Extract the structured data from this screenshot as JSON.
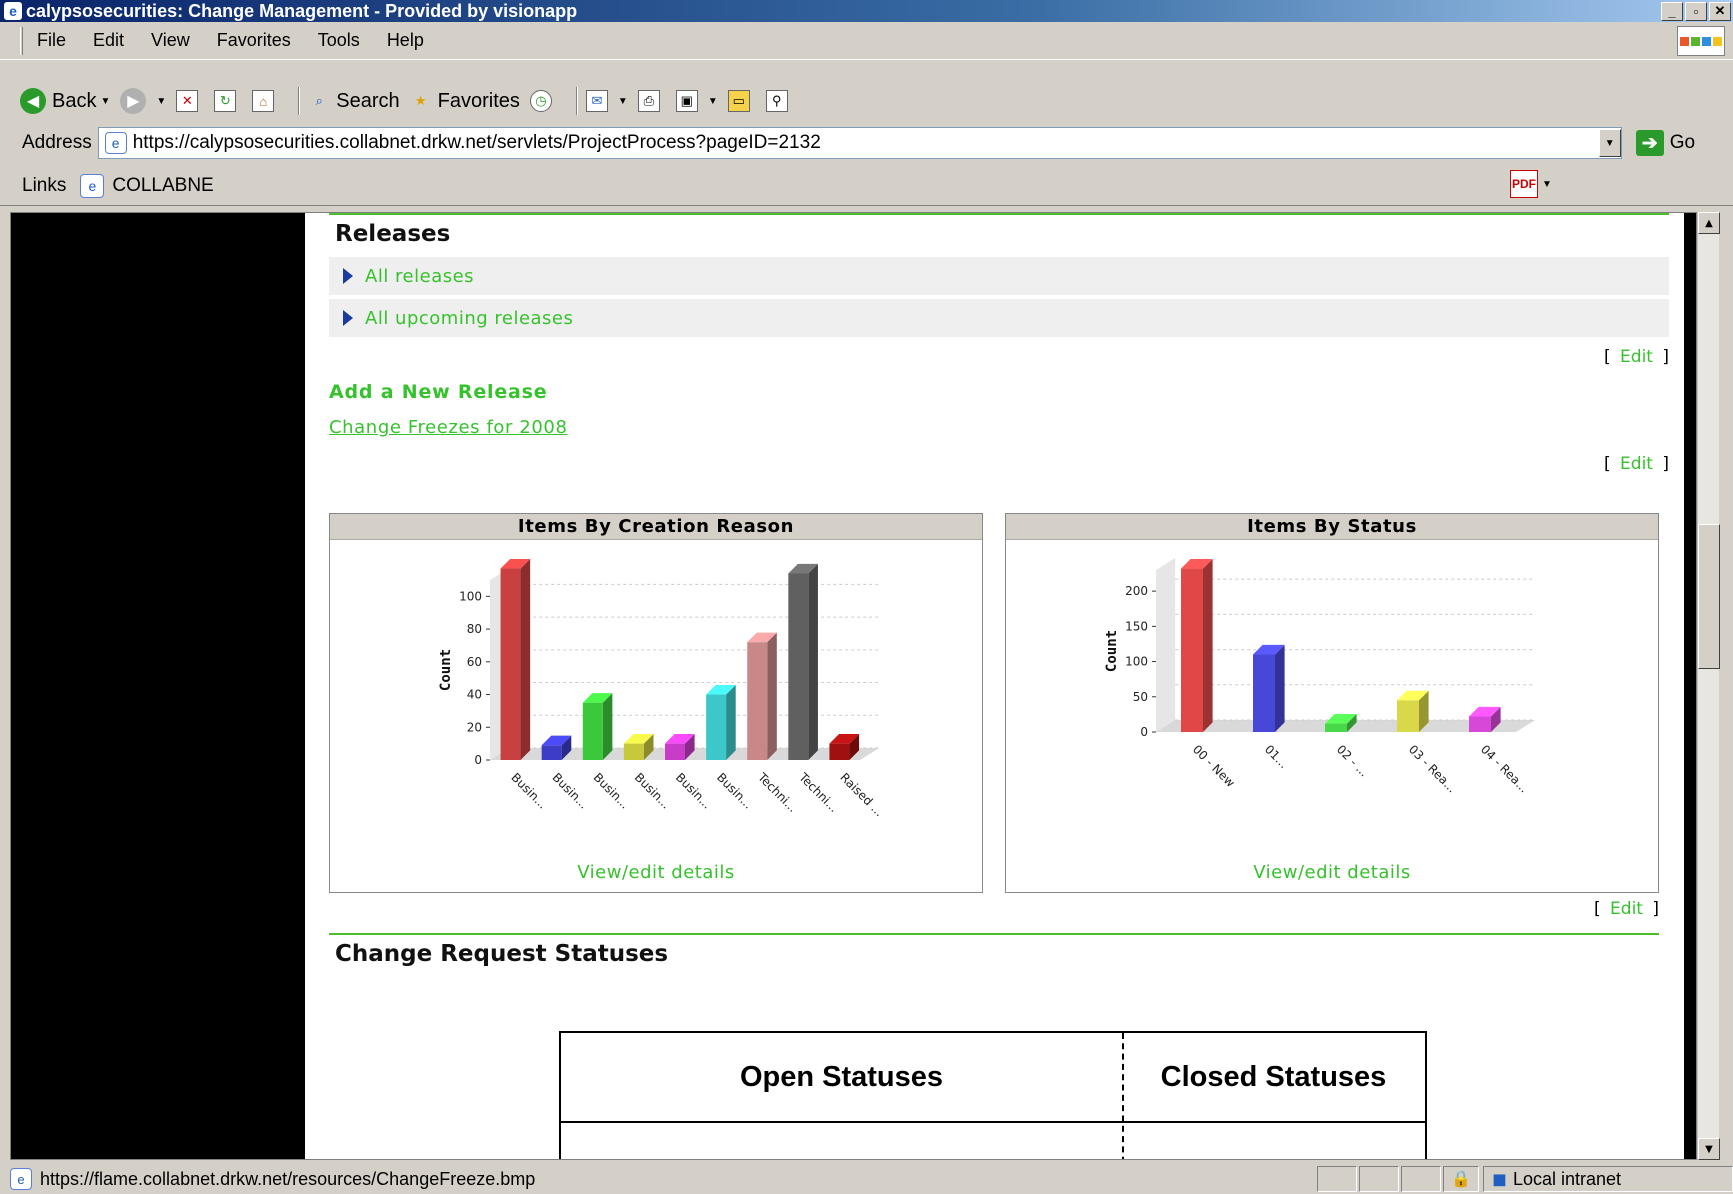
{
  "window": {
    "title": "calypsosecurities: Change Management - Provided by visionapp",
    "minimize": "_",
    "maximize": "▫",
    "close": "✕"
  },
  "menu": [
    "File",
    "Edit",
    "View",
    "Favorites",
    "Tools",
    "Help"
  ],
  "toolbar": {
    "back": "Back",
    "search": "Search",
    "favorites": "Favorites"
  },
  "address": {
    "label": "Address",
    "url": "https://calypsosecurities.collabnet.drkw.net/servlets/ProjectProcess?pageID=2132",
    "go": "Go"
  },
  "links": {
    "label": "Links",
    "item": "COLLABNE"
  },
  "page": {
    "releases_title": "Releases",
    "release_links": [
      "All releases",
      "All upcoming releases"
    ],
    "edit_open": "[",
    "edit_label": "Edit",
    "edit_close": "]",
    "add_release": "Add a New Release",
    "freeze_link": "Change Freezes for 2008",
    "statuses_title": "Change Request Statuses",
    "status_table": {
      "open": "Open Statuses",
      "closed": "Closed  Statuses"
    },
    "accent_color": "#36c22c"
  },
  "chart_data": [
    {
      "type": "bar",
      "title": "Items By Creation Reason",
      "ylabel": "Count",
      "ylim": [
        0,
        110
      ],
      "yticks": [
        0,
        20,
        40,
        60,
        80,
        100
      ],
      "categories": [
        "Busin...",
        "Busin...",
        "Busin...",
        "Busin...",
        "Busin...",
        "Busin...",
        "Techni...",
        "Techni...",
        "Raised ..."
      ],
      "values": [
        117,
        9,
        35,
        10,
        10,
        40,
        72,
        114,
        10
      ],
      "colors": [
        "#c84040",
        "#3c3cc8",
        "#3cc83c",
        "#c8c83c",
        "#c83cc8",
        "#3cc8c8",
        "#c88888",
        "#606060",
        "#a01010"
      ],
      "link": "View/edit details"
    },
    {
      "type": "bar",
      "title": "Items By Status",
      "ylabel": "Count",
      "ylim": [
        0,
        230
      ],
      "yticks": [
        0,
        50,
        100,
        150,
        200
      ],
      "categories": [
        "00 - New",
        "01...",
        "02 - ...",
        "03 - Rea...",
        "04 - Rea..."
      ],
      "values": [
        232,
        110,
        12,
        45,
        22
      ],
      "colors": [
        "#e04848",
        "#4848d8",
        "#48d848",
        "#d8d848",
        "#d848d8"
      ],
      "link": "View/edit details"
    }
  ],
  "statusbar": {
    "url": "https://flame.collabnet.drkw.net/resources/ChangeFreeze.bmp",
    "zone": "Local intranet"
  }
}
